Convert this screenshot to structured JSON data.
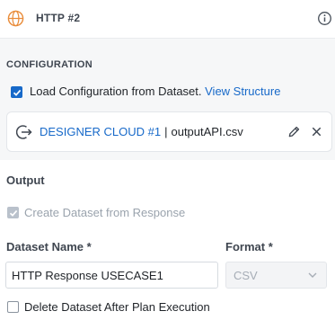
{
  "header": {
    "title": "HTTP #2",
    "icon": "globe-icon",
    "icon_color": "#e98c3a"
  },
  "configuration": {
    "section_title": "CONFIGURATION",
    "load_checkbox": {
      "label": "Load Configuration from Dataset.",
      "checked": true
    },
    "view_structure_link": "View Structure",
    "dataset": {
      "source": "DESIGNER CLOUD #1",
      "separator": "|",
      "file": "outputAPI.csv"
    }
  },
  "output": {
    "section_title": "Output",
    "create_checkbox": {
      "label": "Create Dataset from Response",
      "checked": true,
      "disabled": true
    },
    "dataset_name": {
      "label": "Dataset Name",
      "required_mark": "*",
      "value": "HTTP Response USECASE1"
    },
    "format": {
      "label": "Format",
      "required_mark": "*",
      "value": "CSV",
      "disabled": true
    },
    "delete_checkbox": {
      "label": "Delete Dataset After Plan Execution",
      "checked": false
    }
  },
  "colors": {
    "accent": "#1769c9",
    "section_bg": "#f6f7f8",
    "disabled": "#b9c1cb"
  }
}
